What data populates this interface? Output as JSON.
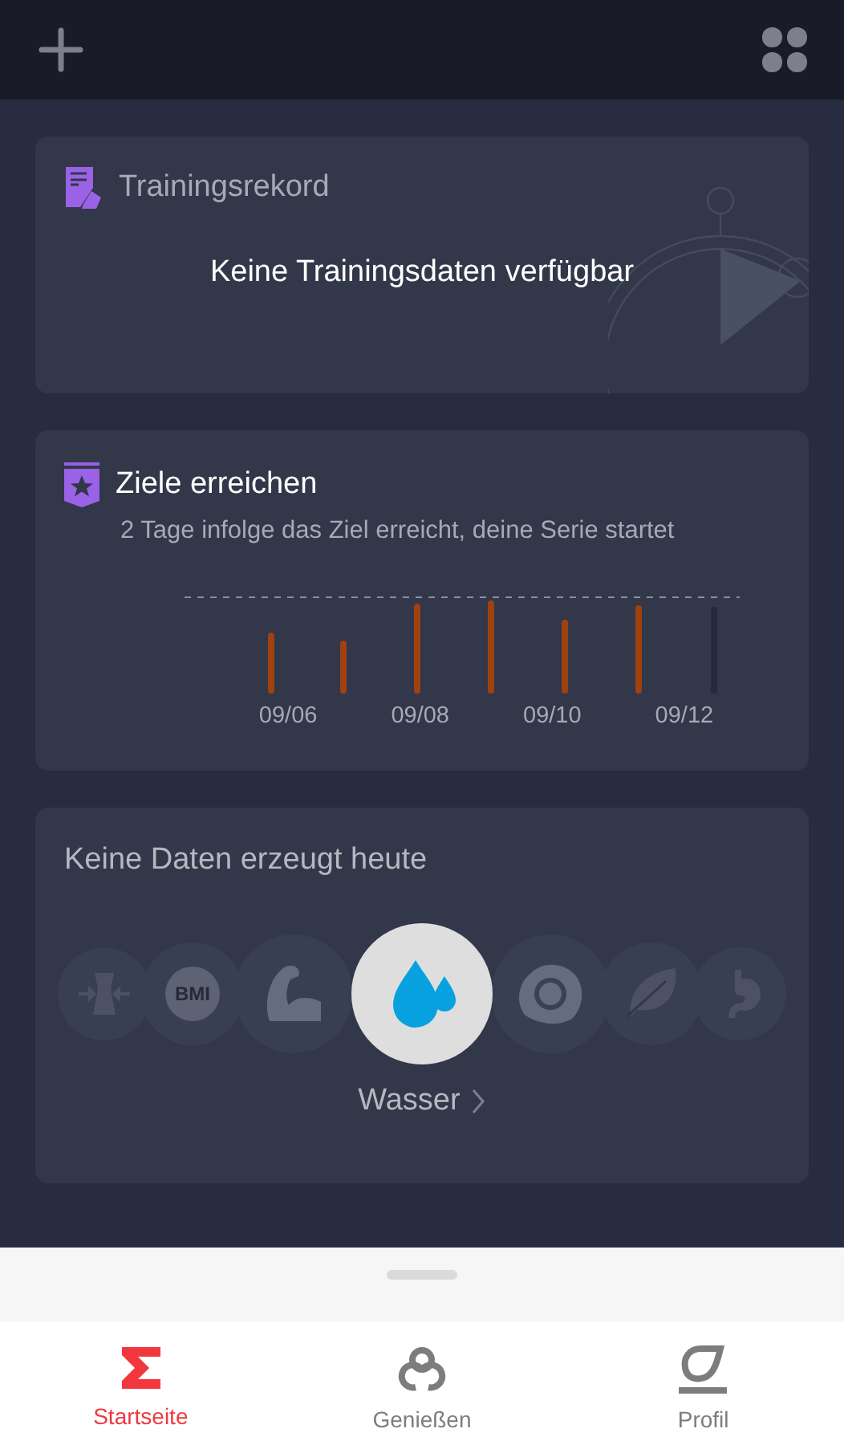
{
  "record": {
    "title": "Trainingsrekord",
    "empty_text": "Keine Trainingsdaten verfügbar"
  },
  "goals": {
    "title": "Ziele erreichen",
    "subtitle": "2 Tage infolge das Ziel erreicht, deine Serie startet",
    "date_labels": [
      "09/06",
      "09/08",
      "09/10",
      "09/12"
    ]
  },
  "today": {
    "title": "Keine Daten erzeugt heute",
    "metrics": [
      {
        "kind": "waist",
        "selected": false
      },
      {
        "kind": "bmi",
        "label": "BMI",
        "selected": false
      },
      {
        "kind": "muscle",
        "selected": false
      },
      {
        "kind": "water",
        "selected": true
      },
      {
        "kind": "food",
        "selected": false
      },
      {
        "kind": "leaf",
        "selected": false
      },
      {
        "kind": "stomach",
        "selected": false
      }
    ],
    "selected_label": "Wasser"
  },
  "tabs": [
    {
      "kind": "home",
      "label": "Startseite",
      "selected": true
    },
    {
      "kind": "enjoy",
      "label": "Genießen",
      "selected": false
    },
    {
      "kind": "profile",
      "label": "Profil",
      "selected": false
    }
  ]
}
